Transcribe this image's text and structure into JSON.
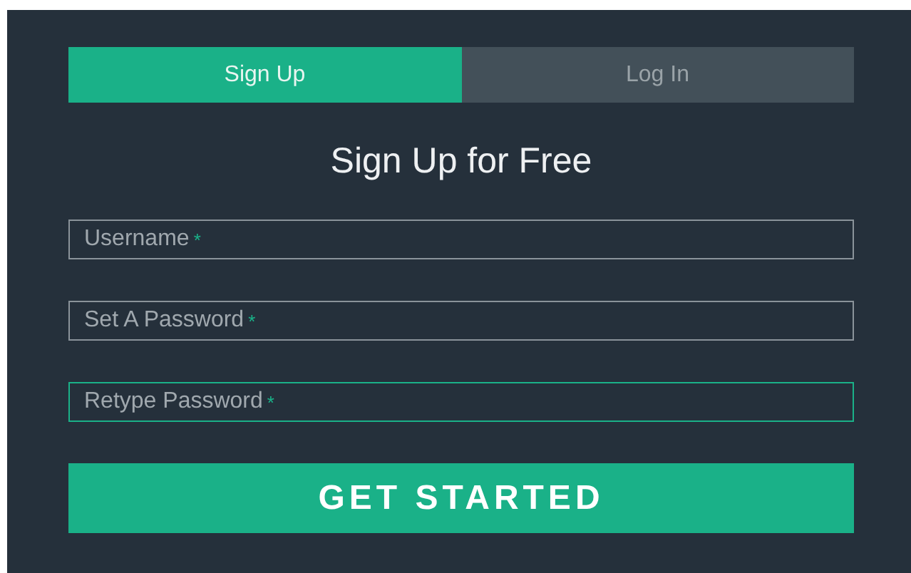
{
  "tabs": [
    {
      "label": "Sign Up",
      "selected": true
    },
    {
      "label": "Log In",
      "selected": false
    }
  ],
  "heading": "Sign Up for Free",
  "fields": [
    {
      "placeholder": "Username",
      "required_mark": "*",
      "focused": false
    },
    {
      "placeholder": "Set A Password",
      "required_mark": "*",
      "focused": false
    },
    {
      "placeholder": "Retype Password",
      "required_mark": "*",
      "focused": true
    }
  ],
  "submit_button": "GET STARTED"
}
